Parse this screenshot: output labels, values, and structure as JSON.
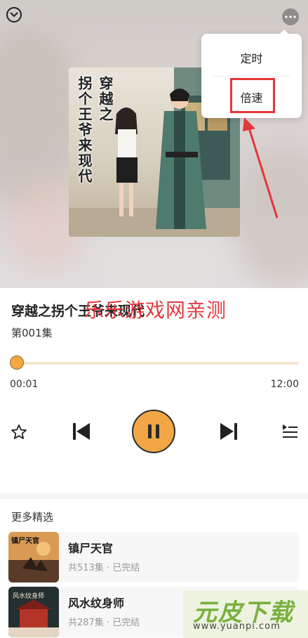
{
  "menu": {
    "timer_label": "定时",
    "speed_label": "倍速"
  },
  "cover": {
    "title_col1": "穿越之",
    "title_col2": "拐个王爷来现代"
  },
  "track": {
    "title": "穿越之拐个王爷来现代",
    "episode": "第001集"
  },
  "watermark": "乐乐游戏网亲测",
  "progress": {
    "current": "00:01",
    "total": "12:00",
    "fraction": 0.0
  },
  "more": {
    "title": "更多精选",
    "items": [
      {
        "title": "镇尸天官",
        "meta": "共513集 · 已完结",
        "thumb_text": "镇尸天官"
      },
      {
        "title": "风水纹身师",
        "meta": "共287集 · 已完结",
        "thumb_text": "风水纹身师"
      }
    ]
  },
  "logo": {
    "name": "元皮下载",
    "url": "www.yuanpi.com"
  },
  "colors": {
    "accent": "#f2a742",
    "highlight": "#e3373b",
    "watermark": "#e5393d"
  }
}
